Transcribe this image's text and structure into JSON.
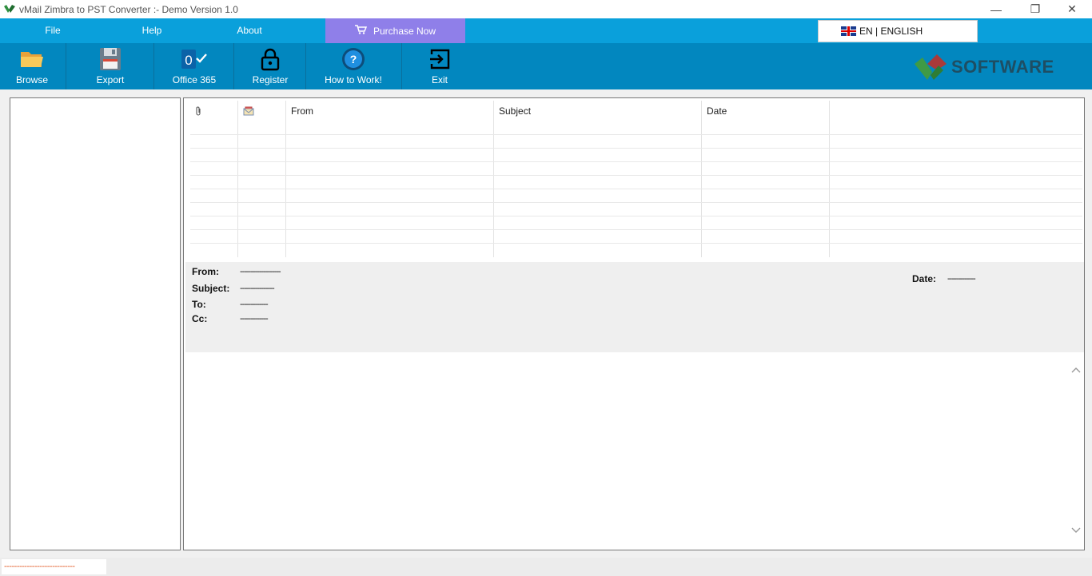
{
  "window": {
    "title": "vMail Zimbra to PST Converter  :- Demo Version 1.0",
    "controls": {
      "minimize": "—",
      "restore": "❐",
      "close": "✕"
    }
  },
  "menu": {
    "items": [
      {
        "label": "File"
      },
      {
        "label": "Help"
      },
      {
        "label": "About"
      }
    ],
    "purchase_label": "Purchase Now",
    "language_label": "EN | ENGLISH"
  },
  "toolbar": {
    "buttons": [
      {
        "label": "Browse",
        "icon": "folder-icon"
      },
      {
        "label": "Export",
        "icon": "floppy-disk-icon"
      },
      {
        "label": "Office 365",
        "icon": "office365-icon"
      },
      {
        "label": "Register",
        "icon": "lock-icon"
      },
      {
        "label": "How to Work!",
        "icon": "help-icon"
      },
      {
        "label": "Exit",
        "icon": "exit-icon"
      }
    ],
    "logo_text": "SOFTWARE"
  },
  "mail_grid": {
    "columns": [
      {
        "label": "",
        "icon": "paperclip-icon"
      },
      {
        "label": "",
        "icon": "envelope-icon"
      },
      {
        "label": "From"
      },
      {
        "label": "Subject"
      },
      {
        "label": "Date"
      },
      {
        "label": ""
      }
    ]
  },
  "detail": {
    "from_label": "From:",
    "from_value": "-------------------",
    "subject_label": "Subject:",
    "subject_value": "----------------",
    "to_label": "To:",
    "to_value": "-------------",
    "cc_label": "Cc:",
    "cc_value": "-------------",
    "date_label": "Date:",
    "date_value": "-------------"
  },
  "status": {
    "text": "----------------------------"
  },
  "colors": {
    "menubar": "#0aa0db",
    "toolbar": "#0287bf",
    "purchase": "#8f7fe9",
    "status_text": "#e25b28"
  }
}
